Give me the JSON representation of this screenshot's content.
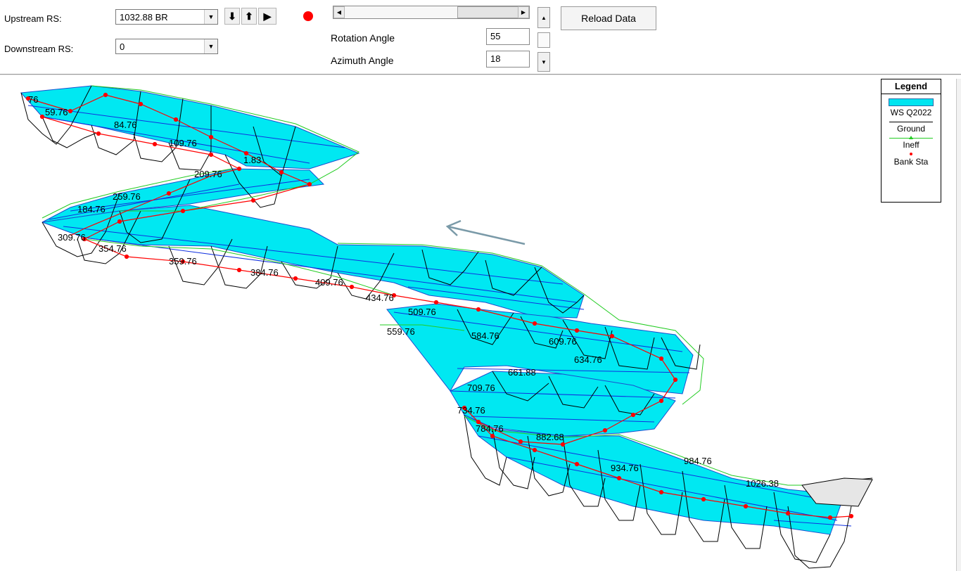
{
  "controls": {
    "upstream_label": "Upstream RS:",
    "upstream_value": "1032.88 BR",
    "downstream_label": "Downstream RS:",
    "downstream_value": "0",
    "rotation_label": "Rotation Angle",
    "rotation_value": "55",
    "azimuth_label": "Azimuth Angle",
    "azimuth_value": "18",
    "reload_label": "Reload Data"
  },
  "legend": {
    "title": "Legend",
    "items": [
      "WS Q2022",
      "Ground",
      "Ineff",
      "Bank Sta"
    ],
    "colors": {
      "ws": "#00e5f0",
      "ground": "#000000",
      "ineff": "#22cc22",
      "bank": "#ff0000"
    }
  },
  "plot": {
    "station_labels": [
      "76",
      "59.76",
      "84.76",
      "109.76",
      "1.83",
      "209.76",
      "259.76",
      "184.76",
      "309.76",
      "354.76",
      "359.76",
      "384.76",
      "409.76",
      "434.76",
      "509.76",
      "559.76",
      "584.76",
      "609.76",
      "634.76",
      "661.88",
      "709.76",
      "734.76",
      "784.76",
      "882.68",
      "934.76",
      "984.76",
      "1026.38"
    ]
  }
}
